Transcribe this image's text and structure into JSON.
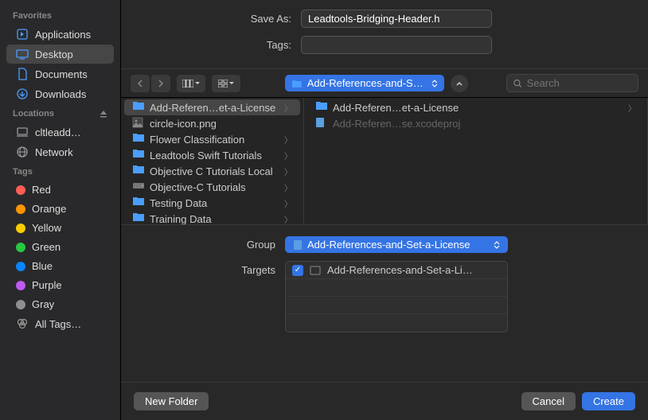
{
  "saveAs": {
    "label": "Save As:",
    "value": "Leadtools-Bridging-Header.h"
  },
  "tags": {
    "label": "Tags:",
    "value": ""
  },
  "toolbar": {
    "pathLabel": "Add-References-and-Se…",
    "searchPlaceholder": "Search"
  },
  "sidebar": {
    "sections": [
      {
        "header": "Favorites",
        "items": [
          {
            "label": "Applications",
            "icon": "applications"
          },
          {
            "label": "Desktop",
            "icon": "desktop",
            "selected": true
          },
          {
            "label": "Documents",
            "icon": "documents"
          },
          {
            "label": "Downloads",
            "icon": "downloads"
          }
        ]
      },
      {
        "header": "Locations",
        "items": [
          {
            "label": "cltleadd…",
            "icon": "computer"
          },
          {
            "label": "Network",
            "icon": "network"
          }
        ],
        "eject": true
      },
      {
        "header": "Tags",
        "items": [
          {
            "label": "Red",
            "tag": "#ff5f56"
          },
          {
            "label": "Orange",
            "tag": "#ff9500"
          },
          {
            "label": "Yellow",
            "tag": "#ffcc00"
          },
          {
            "label": "Green",
            "tag": "#28c840"
          },
          {
            "label": "Blue",
            "tag": "#0a84ff"
          },
          {
            "label": "Purple",
            "tag": "#bf5af2"
          },
          {
            "label": "Gray",
            "tag": "#8e8e93"
          },
          {
            "label": "All Tags…",
            "icon": "alltags"
          }
        ]
      }
    ]
  },
  "columns": {
    "col1": [
      {
        "name": "Add-Referen…et-a-License",
        "type": "folder",
        "selected": true,
        "hasChildren": true
      },
      {
        "name": "circle-icon.png",
        "type": "image"
      },
      {
        "name": "Flower Classification",
        "type": "folder",
        "hasChildren": true
      },
      {
        "name": "Leadtools Swift Tutorials",
        "type": "folder",
        "hasChildren": true
      },
      {
        "name": "Objective C Tutorials Local",
        "type": "folder",
        "hasChildren": true
      },
      {
        "name": "Objective-C Tutorials",
        "type": "hdd",
        "hasChildren": true
      },
      {
        "name": "Testing Data",
        "type": "folder",
        "hasChildren": true
      },
      {
        "name": "Training Data",
        "type": "folder",
        "hasChildren": true
      }
    ],
    "col2": [
      {
        "name": "Add-Referen…et-a-License",
        "type": "folder",
        "hasChildren": true
      },
      {
        "name": "Add-Referen…se.xcodeproj",
        "type": "xcode",
        "dimmed": true
      }
    ]
  },
  "group": {
    "label": "Group",
    "value": "Add-References-and-Set-a-License"
  },
  "targets": {
    "label": "Targets",
    "items": [
      "Add-References-and-Set-a-Li…"
    ]
  },
  "footer": {
    "newFolder": "New Folder",
    "cancel": "Cancel",
    "create": "Create"
  }
}
